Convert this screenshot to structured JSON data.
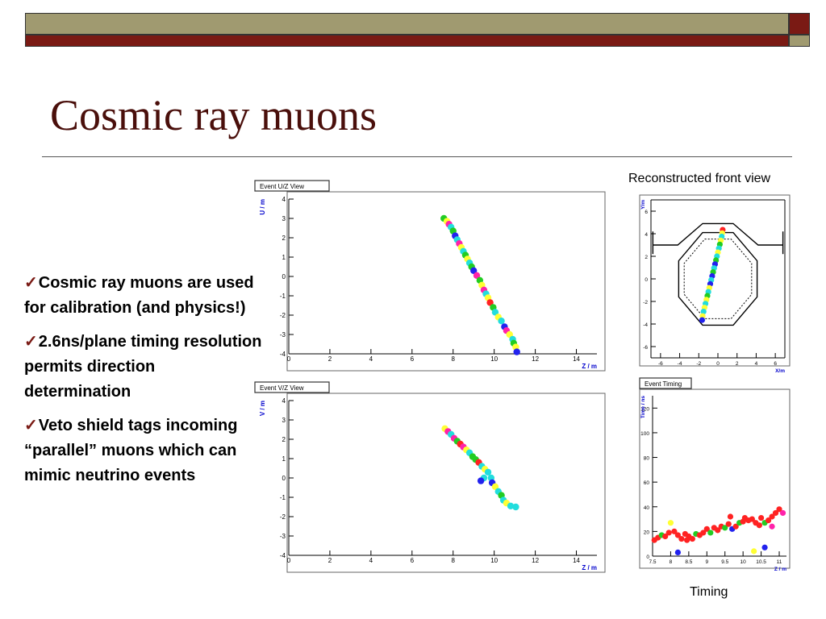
{
  "slide": {
    "title": "Cosmic ray muons",
    "bullets": [
      "Cosmic ray muons are used for calibration (and physics!)",
      "2.6ns/plane timing resolution permits direction determination",
      "Veto shield tags incoming “parallel” muons which can mimic neutrino events"
    ],
    "caption_front": "Reconstructed front view",
    "caption_timing": "Timing",
    "check_glyph": "✓"
  },
  "theme": {
    "accent": "#7a1a14",
    "band": "#a09a70",
    "axis_blue": "#0000cc"
  },
  "chart_data": [
    {
      "id": "uz",
      "type": "scatter",
      "title": "Event U/Z View",
      "xlabel": "Z / m",
      "ylabel": "U / m",
      "xlim": [
        0,
        15
      ],
      "ylim": [
        -4,
        4
      ],
      "xticks": [
        0,
        2,
        4,
        6,
        8,
        10,
        12,
        14
      ],
      "yticks": [
        -4,
        -3,
        -2,
        -1,
        0,
        1,
        2,
        3,
        4
      ],
      "points": [
        [
          7.55,
          3.0,
          "#22cc22"
        ],
        [
          7.7,
          2.85,
          "#ffff33"
        ],
        [
          7.8,
          2.7,
          "#ff22aa"
        ],
        [
          7.9,
          2.55,
          "#22dddd"
        ],
        [
          8.0,
          2.35,
          "#22cc22"
        ],
        [
          8.1,
          2.1,
          "#2222ee"
        ],
        [
          8.2,
          1.9,
          "#22dddd"
        ],
        [
          8.3,
          1.7,
          "#ff22aa"
        ],
        [
          8.4,
          1.5,
          "#ffff33"
        ],
        [
          8.5,
          1.3,
          "#22dddd"
        ],
        [
          8.6,
          1.1,
          "#22cc22"
        ],
        [
          8.7,
          0.9,
          "#ffff33"
        ],
        [
          8.8,
          0.7,
          "#22dddd"
        ],
        [
          8.9,
          0.5,
          "#22cc22"
        ],
        [
          9.0,
          0.3,
          "#2222ee"
        ],
        [
          9.15,
          0.05,
          "#ff22aa"
        ],
        [
          9.3,
          -0.2,
          "#22cc22"
        ],
        [
          9.4,
          -0.45,
          "#ffff33"
        ],
        [
          9.5,
          -0.7,
          "#ff22aa"
        ],
        [
          9.6,
          -0.9,
          "#22dddd"
        ],
        [
          9.7,
          -1.1,
          "#ffff33"
        ],
        [
          9.8,
          -1.35,
          "#ff2222"
        ],
        [
          9.95,
          -1.6,
          "#22cc22"
        ],
        [
          10.05,
          -1.85,
          "#22dddd"
        ],
        [
          10.2,
          -2.1,
          "#ffff33"
        ],
        [
          10.35,
          -2.3,
          "#22dddd"
        ],
        [
          10.5,
          -2.6,
          "#2222ee"
        ],
        [
          10.6,
          -2.8,
          "#ff22aa"
        ],
        [
          10.75,
          -3.0,
          "#ffff33"
        ],
        [
          10.9,
          -3.25,
          "#22dddd"
        ],
        [
          10.95,
          -3.45,
          "#22cc22"
        ],
        [
          11.05,
          -3.65,
          "#ffff33"
        ],
        [
          11.1,
          -3.9,
          "#2222ee"
        ]
      ]
    },
    {
      "id": "vz",
      "type": "scatter",
      "title": "Event V/Z View",
      "xlabel": "Z / m",
      "ylabel": "V / m",
      "xlim": [
        0,
        15
      ],
      "ylim": [
        -4,
        4
      ],
      "xticks": [
        0,
        2,
        4,
        6,
        8,
        10,
        12,
        14
      ],
      "yticks": [
        -4,
        -3,
        -2,
        -1,
        0,
        1,
        2,
        3,
        4
      ],
      "points": [
        [
          7.6,
          2.55,
          "#ffff33"
        ],
        [
          7.75,
          2.4,
          "#ff22aa"
        ],
        [
          7.9,
          2.25,
          "#22dddd"
        ],
        [
          8.05,
          2.05,
          "#ff22aa"
        ],
        [
          8.2,
          1.9,
          "#22cc22"
        ],
        [
          8.35,
          1.75,
          "#ff2222"
        ],
        [
          8.5,
          1.6,
          "#ff22aa"
        ],
        [
          8.65,
          1.45,
          "#ffff33"
        ],
        [
          8.8,
          1.3,
          "#22dddd"
        ],
        [
          8.95,
          1.1,
          "#22cc22"
        ],
        [
          9.1,
          0.95,
          "#22cc22"
        ],
        [
          9.25,
          0.8,
          "#ff2222"
        ],
        [
          9.4,
          0.6,
          "#22dddd"
        ],
        [
          9.55,
          0.45,
          "#ffff33"
        ],
        [
          9.7,
          0.3,
          "#22dddd"
        ],
        [
          9.5,
          0.0,
          "#22dddd"
        ],
        [
          9.85,
          0.0,
          "#22dddd"
        ],
        [
          9.35,
          -0.15,
          "#2222ee"
        ],
        [
          9.9,
          -0.25,
          "#2222ee"
        ],
        [
          10.05,
          -0.45,
          "#ffff33"
        ],
        [
          10.2,
          -0.7,
          "#22dddd"
        ],
        [
          10.35,
          -0.9,
          "#22cc22"
        ],
        [
          10.45,
          -1.15,
          "#22dddd"
        ],
        [
          10.6,
          -1.3,
          "#ffff33"
        ],
        [
          10.8,
          -1.45,
          "#22dddd"
        ],
        [
          11.05,
          -1.5,
          "#22dddd"
        ]
      ]
    },
    {
      "id": "front",
      "type": "scatter",
      "title": "",
      "xlabel": "X/m",
      "ylabel": "Y/m",
      "xlim": [
        -7,
        7
      ],
      "ylim": [
        -7,
        7
      ],
      "xticks": [
        -6,
        -4,
        -2,
        0,
        2,
        4,
        6
      ],
      "yticks": [
        -6,
        -4,
        -2,
        0,
        2,
        4,
        6
      ],
      "points": [
        [
          0.5,
          4.35,
          "#ff2222"
        ],
        [
          0.45,
          4.05,
          "#ffff33"
        ],
        [
          0.4,
          3.75,
          "#22dddd"
        ],
        [
          0.3,
          3.4,
          "#ffff33"
        ],
        [
          0.2,
          3.05,
          "#22cc22"
        ],
        [
          0.1,
          2.7,
          "#22dddd"
        ],
        [
          0.0,
          2.35,
          "#ffff33"
        ],
        [
          -0.1,
          2.0,
          "#22dddd"
        ],
        [
          -0.2,
          1.65,
          "#22cc22"
        ],
        [
          -0.3,
          1.3,
          "#2222ee"
        ],
        [
          -0.4,
          0.95,
          "#22dddd"
        ],
        [
          -0.5,
          0.6,
          "#22cc22"
        ],
        [
          -0.6,
          0.25,
          "#2222ee"
        ],
        [
          -0.7,
          -0.1,
          "#22dddd"
        ],
        [
          -0.8,
          -0.45,
          "#2222ee"
        ],
        [
          -0.9,
          -0.8,
          "#ffff33"
        ],
        [
          -1.0,
          -1.15,
          "#22dddd"
        ],
        [
          -1.1,
          -1.5,
          "#22cc22"
        ],
        [
          -1.2,
          -1.85,
          "#ffff33"
        ],
        [
          -1.3,
          -2.2,
          "#22dddd"
        ],
        [
          -1.4,
          -2.55,
          "#ffff33"
        ],
        [
          -1.5,
          -2.9,
          "#22dddd"
        ],
        [
          -1.6,
          -3.3,
          "#ffff33"
        ],
        [
          -1.65,
          -3.65,
          "#2222ee"
        ]
      ]
    },
    {
      "id": "timing",
      "type": "scatter",
      "title": "Event Timing",
      "xlabel": "Z / m",
      "ylabel": "Time / ns",
      "xlim": [
        7.5,
        11.2
      ],
      "ylim": [
        0,
        130
      ],
      "xticks": [
        7.5,
        8,
        8.5,
        9,
        9.5,
        10,
        10.5,
        11
      ],
      "yticks": [
        0,
        20,
        40,
        60,
        80,
        100,
        120
      ],
      "points": [
        [
          7.55,
          13,
          "#ff2222"
        ],
        [
          7.65,
          15,
          "#ff2222"
        ],
        [
          7.75,
          17,
          "#22cc22"
        ],
        [
          7.85,
          16,
          "#ff2222"
        ],
        [
          7.95,
          19,
          "#ff2222"
        ],
        [
          8.0,
          27,
          "#ffff33"
        ],
        [
          8.1,
          20,
          "#ff2222"
        ],
        [
          8.2,
          17,
          "#ff2222"
        ],
        [
          8.3,
          14,
          "#ff2222"
        ],
        [
          8.4,
          18,
          "#ff2222"
        ],
        [
          8.45,
          13,
          "#ff2222"
        ],
        [
          8.5,
          16,
          "#ff2222"
        ],
        [
          8.6,
          14,
          "#ff2222"
        ],
        [
          8.7,
          18,
          "#22cc22"
        ],
        [
          8.8,
          17,
          "#ff2222"
        ],
        [
          8.9,
          19,
          "#ff2222"
        ],
        [
          9.0,
          22,
          "#ff2222"
        ],
        [
          9.1,
          19,
          "#22cc22"
        ],
        [
          9.2,
          23,
          "#ff2222"
        ],
        [
          9.3,
          21,
          "#ff2222"
        ],
        [
          9.4,
          24,
          "#ff2222"
        ],
        [
          9.5,
          23,
          "#22cc22"
        ],
        [
          9.6,
          26,
          "#ff2222"
        ],
        [
          9.65,
          32,
          "#ff2222"
        ],
        [
          9.7,
          22,
          "#2222ee"
        ],
        [
          9.8,
          24,
          "#ff2222"
        ],
        [
          9.9,
          27,
          "#22cc22"
        ],
        [
          10.0,
          28,
          "#ff2222"
        ],
        [
          10.05,
          31,
          "#ff2222"
        ],
        [
          10.15,
          29,
          "#ff2222"
        ],
        [
          10.25,
          30,
          "#ff2222"
        ],
        [
          10.35,
          27,
          "#ff2222"
        ],
        [
          10.45,
          25,
          "#ff2222"
        ],
        [
          10.5,
          31,
          "#ff2222"
        ],
        [
          10.6,
          27,
          "#22cc22"
        ],
        [
          10.7,
          29,
          "#ff2222"
        ],
        [
          10.8,
          32,
          "#ff2222"
        ],
        [
          10.9,
          35,
          "#ff2222"
        ],
        [
          11.0,
          38,
          "#ff2222"
        ],
        [
          11.1,
          35,
          "#ff22aa"
        ],
        [
          8.2,
          3,
          "#2222ee"
        ],
        [
          10.6,
          7,
          "#2222ee"
        ],
        [
          10.3,
          4,
          "#ffff33"
        ],
        [
          10.8,
          24,
          "#ff22aa"
        ]
      ]
    }
  ]
}
